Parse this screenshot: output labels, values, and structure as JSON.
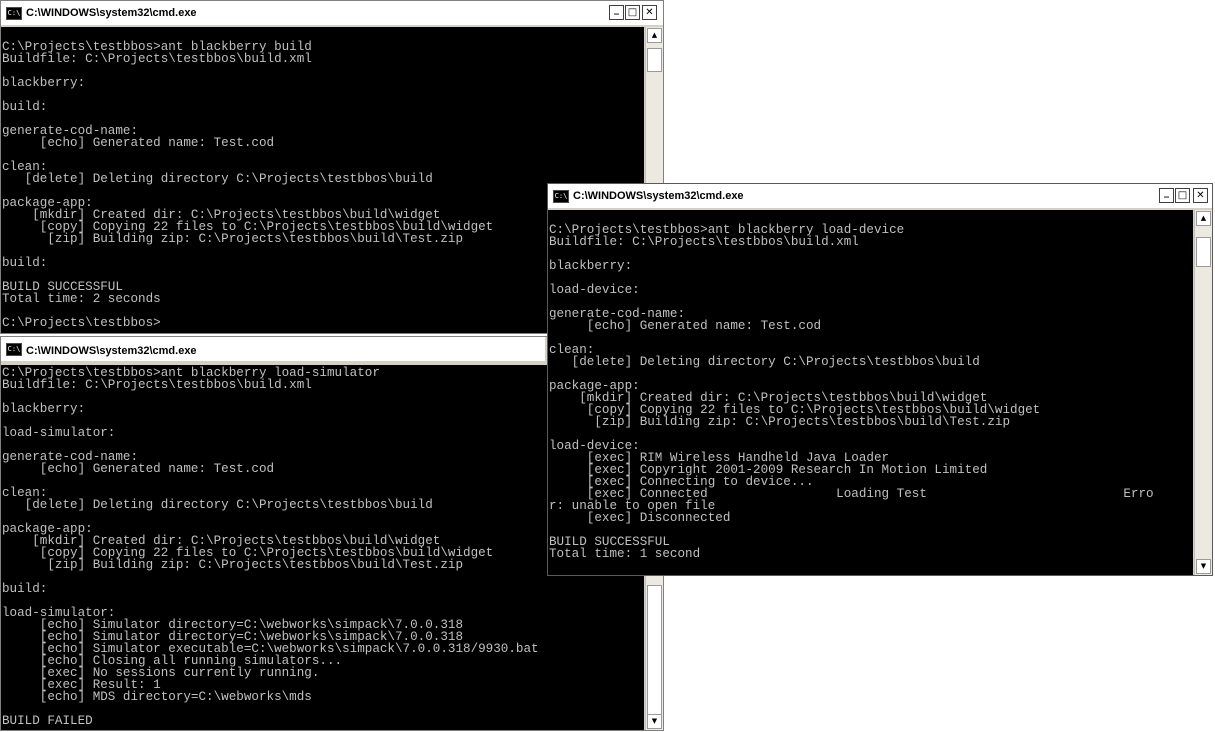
{
  "windows": [
    {
      "title": "C:\\WINDOWS\\system32\\cmd.exe",
      "icon_label": "C:\\",
      "lines": [
        "",
        "C:\\Projects\\testbbos>ant blackberry build",
        "Buildfile: C:\\Projects\\testbbos\\build.xml",
        "",
        "blackberry:",
        "",
        "build:",
        "",
        "generate-cod-name:",
        "     [echo] Generated name: Test.cod",
        "",
        "clean:",
        "   [delete] Deleting directory C:\\Projects\\testbbos\\build",
        "",
        "package-app:",
        "    [mkdir] Created dir: C:\\Projects\\testbbos\\build\\widget",
        "     [copy] Copying 22 files to C:\\Projects\\testbbos\\build\\widget",
        "      [zip] Building zip: C:\\Projects\\testbbos\\build\\Test.zip",
        "",
        "build:",
        "",
        "BUILD SUCCESSFUL",
        "Total time: 2 seconds",
        "",
        "C:\\Projects\\testbbos>"
      ]
    },
    {
      "title": "C:\\WINDOWS\\system32\\cmd.exe",
      "icon_label": "C:\\",
      "lines": [
        "C:\\Projects\\testbbos>ant blackberry load-simulator",
        "Buildfile: C:\\Projects\\testbbos\\build.xml",
        "",
        "blackberry:",
        "",
        "load-simulator:",
        "",
        "generate-cod-name:",
        "     [echo] Generated name: Test.cod",
        "",
        "clean:",
        "   [delete] Deleting directory C:\\Projects\\testbbos\\build",
        "",
        "package-app:",
        "    [mkdir] Created dir: C:\\Projects\\testbbos\\build\\widget",
        "     [copy] Copying 22 files to C:\\Projects\\testbbos\\build\\widget",
        "      [zip] Building zip: C:\\Projects\\testbbos\\build\\Test.zip",
        "",
        "build:",
        "",
        "load-simulator:",
        "     [echo] Simulator directory=C:\\webworks\\simpack\\7.0.0.318",
        "     [echo] Simulator directory=C:\\webworks\\simpack\\7.0.0.318",
        "     [echo] Simulator executable=C:\\webworks\\simpack\\7.0.0.318/9930.bat",
        "     [echo] Closing all running simulators...",
        "     [exec] No sessions currently running.",
        "     [exec] Result: 1",
        "     [echo] MDS directory=C:\\webworks\\mds",
        "",
        "BUILD FAILED"
      ]
    },
    {
      "title": "C:\\WINDOWS\\system32\\cmd.exe",
      "icon_label": "C:\\",
      "lines": [
        "",
        "C:\\Projects\\testbbos>ant blackberry load-device",
        "Buildfile: C:\\Projects\\testbbos\\build.xml",
        "",
        "blackberry:",
        "",
        "load-device:",
        "",
        "generate-cod-name:",
        "     [echo] Generated name: Test.cod",
        "",
        "clean:",
        "   [delete] Deleting directory C:\\Projects\\testbbos\\build",
        "",
        "package-app:",
        "    [mkdir] Created dir: C:\\Projects\\testbbos\\build\\widget",
        "     [copy] Copying 22 files to C:\\Projects\\testbbos\\build\\widget",
        "      [zip] Building zip: C:\\Projects\\testbbos\\build\\Test.zip",
        "",
        "load-device:",
        "     [exec] RIM Wireless Handheld Java Loader",
        "     [exec] Copyright 2001-2009 Research In Motion Limited",
        "     [exec] Connecting to device...",
        "     [exec] Connected                 Loading Test                          Erro",
        "r: unable to open file",
        "     [exec] Disconnected",
        "",
        "BUILD SUCCESSFUL",
        "Total time: 1 second"
      ]
    }
  ],
  "controls": {
    "minimize": "_",
    "maximize": "□",
    "close": "✕",
    "scroll_up": "▲",
    "scroll_down": "▼"
  },
  "colors": {
    "console_bg": "#000000",
    "console_text": "#c0c0c0",
    "titlebar_bg": "#ffffff"
  }
}
